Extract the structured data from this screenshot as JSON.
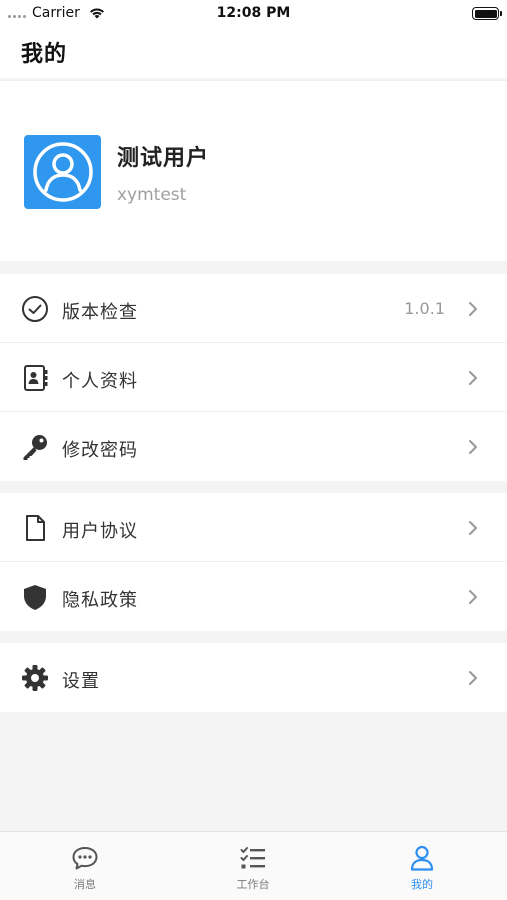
{
  "status_bar": {
    "carrier": "Carrier",
    "time": "12:08 PM"
  },
  "header": {
    "title": "我的"
  },
  "profile": {
    "name": "测试用户",
    "account": "xymtest",
    "avatar_color": "#2f97ee"
  },
  "menu_groups": [
    {
      "items": [
        {
          "icon": "check-circle-icon",
          "label": "版本检查",
          "value": "1.0.1"
        },
        {
          "icon": "contact-card-icon",
          "label": "个人资料"
        },
        {
          "icon": "key-icon",
          "label": "修改密码"
        }
      ]
    },
    {
      "items": [
        {
          "icon": "document-icon",
          "label": "用户协议"
        },
        {
          "icon": "shield-icon",
          "label": "隐私政策"
        }
      ]
    },
    {
      "items": [
        {
          "icon": "gear-icon",
          "label": "设置"
        }
      ]
    }
  ],
  "tab_bar": {
    "tabs": [
      {
        "icon": "chat-bubble-icon",
        "label": "消息",
        "active": false
      },
      {
        "icon": "task-list-icon",
        "label": "工作台",
        "active": false
      },
      {
        "icon": "person-icon",
        "label": "我的",
        "active": true
      }
    ],
    "active_color": "#2f8ef0"
  }
}
